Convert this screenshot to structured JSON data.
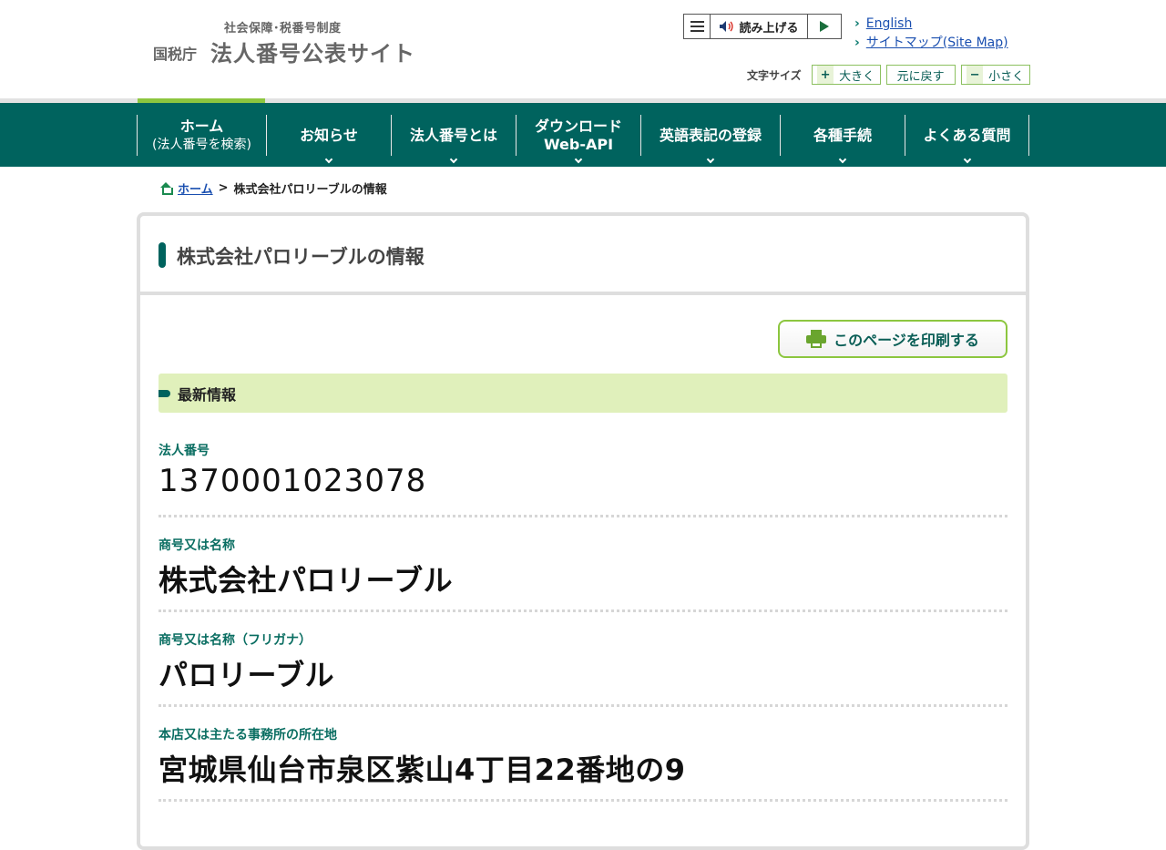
{
  "header": {
    "logo_sub": "社会保障･税番号制度",
    "logo_org": "国税庁",
    "logo_title": "法人番号公表サイト",
    "read_aloud_label": "読み上げる",
    "links": [
      "English",
      "サイトマップ(Site Map)"
    ],
    "font_size": {
      "label": "文字サイズ",
      "larger": "大きく",
      "reset": "元に戻す",
      "smaller": "小さく"
    }
  },
  "nav": {
    "items": [
      {
        "label": "ホーム",
        "sub": "(法人番号を検索)"
      },
      {
        "label": "お知らせ"
      },
      {
        "label": "法人番号とは"
      },
      {
        "label": "ダウンロード",
        "sub": "Web-API"
      },
      {
        "label": "英語表記の登録"
      },
      {
        "label": "各種手続"
      },
      {
        "label": "よくある質問"
      }
    ]
  },
  "breadcrumb": {
    "home": "ホーム",
    "separator": ">",
    "current": "株式会社パロリーブルの情報"
  },
  "main": {
    "title": "株式会社パロリーブルの情報",
    "print_label": "このページを印刷する",
    "section_label": "最新情報",
    "fields": [
      {
        "label": "法人番号",
        "value": "1370001023078"
      },
      {
        "label": "商号又は名称",
        "value": "株式会社パロリーブル"
      },
      {
        "label": "商号又は名称（フリガナ）",
        "value": "パロリーブル"
      },
      {
        "label": "本店又は主たる事務所の所在地",
        "value": "宮城県仙台市泉区紫山4丁目22番地の9"
      }
    ]
  },
  "colors": {
    "nav_bg": "#00635e",
    "accent_green": "#8cc63f",
    "section_bg": "#e0f0bb",
    "link": "#1a4fb0"
  }
}
